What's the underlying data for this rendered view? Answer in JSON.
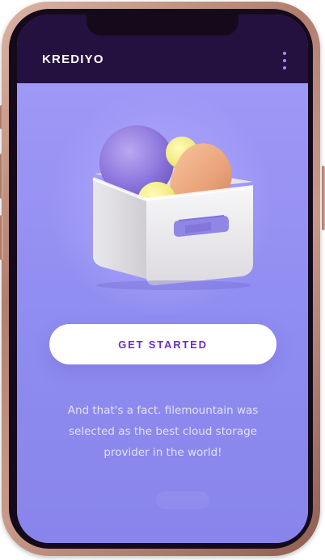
{
  "app": {
    "title": "KREDIYO",
    "menu_icon": "more-vertical-icon"
  },
  "hero": {
    "illustration_icon": "storage-box-icon"
  },
  "cta": {
    "label": "GET STARTED"
  },
  "description": {
    "text": "And that's a fact. filemountain was selected  as the best cloud storage provider in the world!"
  },
  "colors": {
    "header_bg": "#24113f",
    "content_bg": "#8f8cf0",
    "accent": "#6a2fc9",
    "menu_dots": "#b184ff",
    "frame": "#c99a8a"
  }
}
